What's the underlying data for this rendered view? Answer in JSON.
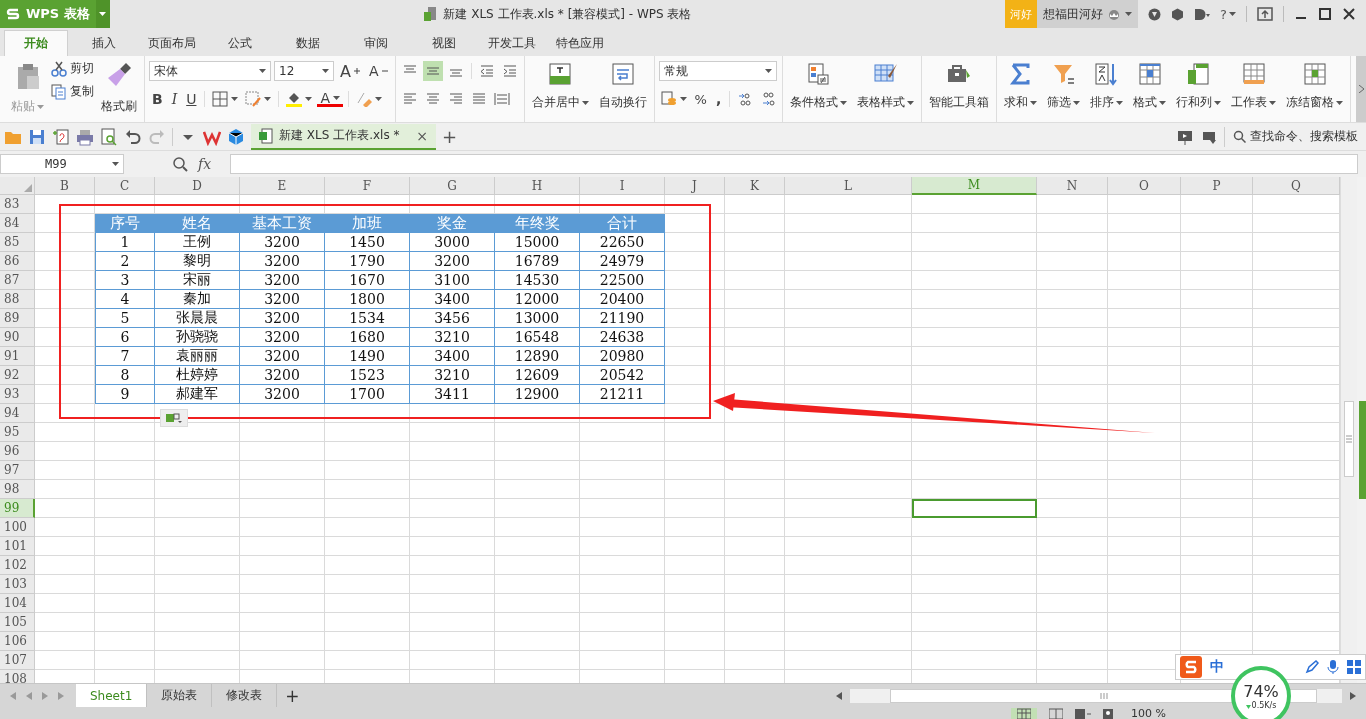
{
  "title_bar": {
    "app_button": "WPS 表格",
    "document_title": "新建 XLS 工作表.xls * [兼容模式] - WPS 表格",
    "account_badge": "河好",
    "user_name": "想福田河好",
    "help": "?"
  },
  "tabs": [
    {
      "label": "开始",
      "selected": true
    },
    {
      "label": "插入",
      "selected": false
    },
    {
      "label": "页面布局",
      "selected": false
    },
    {
      "label": "公式",
      "selected": false
    },
    {
      "label": "数据",
      "selected": false
    },
    {
      "label": "审阅",
      "selected": false
    },
    {
      "label": "视图",
      "selected": false
    },
    {
      "label": "开发工具",
      "selected": false
    },
    {
      "label": "特色应用",
      "selected": false
    }
  ],
  "ribbon": {
    "clipboard": {
      "paste": "粘贴",
      "cut": "剪切",
      "copy": "复制",
      "format_painter": "格式刷"
    },
    "font": {
      "name": "宋体",
      "size": "12",
      "grow": "A",
      "shrink": "A",
      "bold": "B",
      "italic": "I",
      "underline": "U",
      "font_color": "A"
    },
    "vertical_align": [
      {
        "selected": false
      },
      {
        "selected": true
      },
      {
        "selected": false
      }
    ],
    "number_format": "常规",
    "percent": "%",
    "comma": ",",
    "buttons": [
      {
        "label": "合并居中",
        "menu": true
      },
      {
        "label": "自动换行",
        "menu": false
      },
      {
        "label": "条件格式",
        "menu": true
      },
      {
        "label": "表格样式",
        "menu": true
      },
      {
        "label": "智能工具箱",
        "menu": false
      },
      {
        "label": "求和",
        "menu": true
      },
      {
        "label": "筛选",
        "menu": true
      },
      {
        "label": "排序",
        "menu": true
      },
      {
        "label": "格式",
        "menu": true
      },
      {
        "label": "行和列",
        "menu": true
      },
      {
        "label": "工作表",
        "menu": true
      },
      {
        "label": "冻结窗格",
        "menu": true
      }
    ]
  },
  "document_tab": {
    "label": "新建 XLS 工作表.xls *",
    "close": "×",
    "new_tab": "+"
  },
  "search": {
    "placeholder": "查找命令、搜索模板"
  },
  "formula_bar": {
    "name_box": "M99",
    "function_label": "fx"
  },
  "sheet": {
    "columns": [
      {
        "label": "B",
        "selected": false
      },
      {
        "label": "C",
        "selected": false
      },
      {
        "label": "D",
        "selected": false
      },
      {
        "label": "E",
        "selected": false
      },
      {
        "label": "F",
        "selected": false
      },
      {
        "label": "G",
        "selected": false
      },
      {
        "label": "H",
        "selected": false
      },
      {
        "label": "I",
        "selected": false
      },
      {
        "label": "J",
        "selected": false
      },
      {
        "label": "K",
        "selected": false
      },
      {
        "label": "L",
        "selected": false
      },
      {
        "label": "M",
        "selected": true
      },
      {
        "label": "N",
        "selected": false
      },
      {
        "label": "O",
        "selected": false
      },
      {
        "label": "P",
        "selected": false
      },
      {
        "label": "Q",
        "selected": false
      }
    ],
    "rows": [
      {
        "number": "83",
        "selected": false,
        "kind": "empty"
      },
      {
        "number": "84",
        "selected": false,
        "kind": "header",
        "cells": [
          "序号",
          "姓名",
          "基本工资",
          "加班",
          "奖金",
          "年终奖",
          "合计"
        ]
      },
      {
        "number": "85",
        "selected": false,
        "kind": "data",
        "cells": [
          "1",
          "王例",
          "3200",
          "1450",
          "3000",
          "15000",
          "22650"
        ]
      },
      {
        "number": "86",
        "selected": false,
        "kind": "data",
        "cells": [
          "2",
          "黎明",
          "3200",
          "1790",
          "3200",
          "16789",
          "24979"
        ]
      },
      {
        "number": "87",
        "selected": false,
        "kind": "data",
        "cells": [
          "3",
          "宋丽",
          "3200",
          "1670",
          "3100",
          "14530",
          "22500"
        ]
      },
      {
        "number": "88",
        "selected": false,
        "kind": "data",
        "cells": [
          "4",
          "秦加",
          "3200",
          "1800",
          "3400",
          "12000",
          "20400"
        ]
      },
      {
        "number": "89",
        "selected": false,
        "kind": "data",
        "cells": [
          "5",
          "张晨晨",
          "3200",
          "1534",
          "3456",
          "13000",
          "21190"
        ]
      },
      {
        "number": "90",
        "selected": false,
        "kind": "data",
        "cells": [
          "6",
          "孙骁骁",
          "3200",
          "1680",
          "3210",
          "16548",
          "24638"
        ]
      },
      {
        "number": "91",
        "selected": false,
        "kind": "data",
        "cells": [
          "7",
          "袁丽丽",
          "3200",
          "1490",
          "3400",
          "12890",
          "20980"
        ]
      },
      {
        "number": "92",
        "selected": false,
        "kind": "data",
        "cells": [
          "8",
          "杜婷婷",
          "3200",
          "1523",
          "3210",
          "12609",
          "20542"
        ]
      },
      {
        "number": "93",
        "selected": false,
        "kind": "data",
        "cells": [
          "9",
          "郝建军",
          "3200",
          "1700",
          "3411",
          "12900",
          "21211"
        ]
      },
      {
        "number": "94",
        "selected": false,
        "kind": "empty"
      },
      {
        "number": "95",
        "selected": false,
        "kind": "empty"
      },
      {
        "number": "96",
        "selected": false,
        "kind": "empty"
      },
      {
        "number": "97",
        "selected": false,
        "kind": "empty"
      },
      {
        "number": "98",
        "selected": false,
        "kind": "empty"
      },
      {
        "number": "99",
        "selected": true,
        "kind": "empty"
      },
      {
        "number": "100",
        "selected": false,
        "kind": "empty"
      },
      {
        "number": "101",
        "selected": false,
        "kind": "empty"
      },
      {
        "number": "102",
        "selected": false,
        "kind": "empty"
      },
      {
        "number": "103",
        "selected": false,
        "kind": "empty"
      },
      {
        "number": "104",
        "selected": false,
        "kind": "empty"
      },
      {
        "number": "105",
        "selected": false,
        "kind": "empty"
      },
      {
        "number": "106",
        "selected": false,
        "kind": "empty"
      },
      {
        "number": "107",
        "selected": false,
        "kind": "empty"
      },
      {
        "number": "108",
        "selected": false,
        "kind": "empty"
      }
    ]
  },
  "sheet_tabs": {
    "tabs": [
      {
        "label": "Sheet1",
        "selected": true
      },
      {
        "label": "原始表",
        "selected": false
      },
      {
        "label": "修改表",
        "selected": false
      }
    ],
    "add": "+"
  },
  "status_bar": {
    "zoom": "100 %"
  },
  "overlays": {
    "ime_mode": "中",
    "speed_percent": "74%",
    "speed_rate": "0.5K/s"
  }
}
